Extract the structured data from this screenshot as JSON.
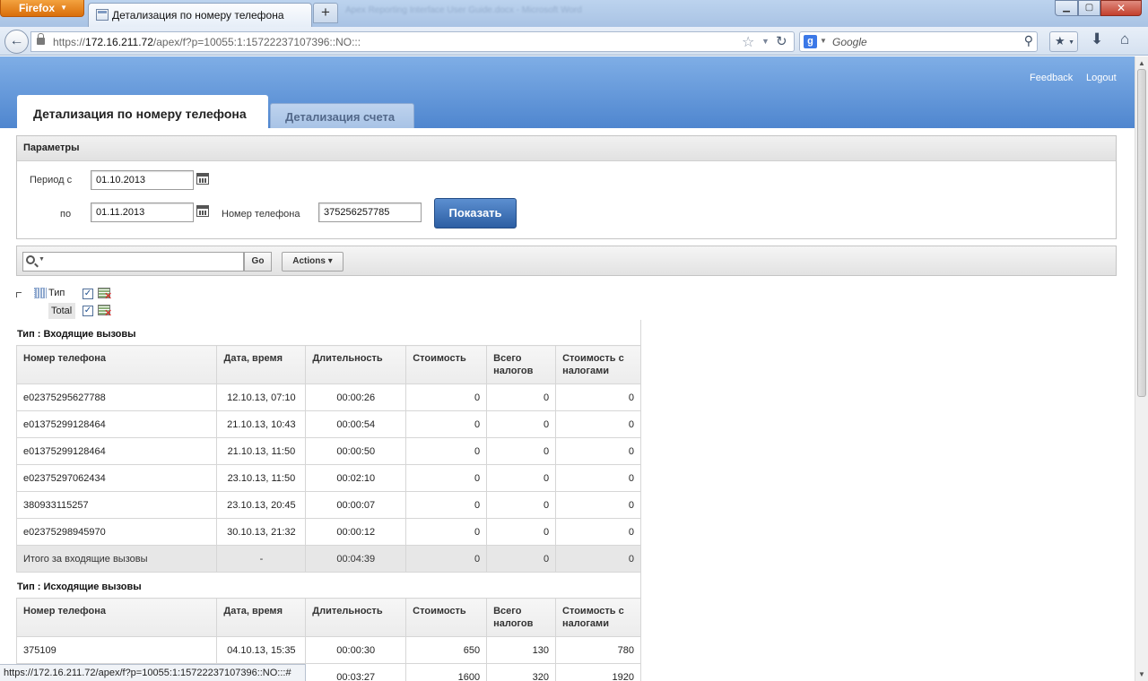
{
  "browser": {
    "menu_label": "Firefox",
    "tab_title": "Детализация по номеру телефона",
    "newtab_label": "+",
    "blurred_window_title": "Apex Reporting Interface User Guide.docx - Microsoft Word",
    "url_prefix": "https://",
    "url_host": "172.16.211.72",
    "url_path": "/apex/f?p=10055:1:15722237107396::NO:::",
    "search_placeholder": "Google",
    "status_url": "https://172.16.211.72/apex/f?p=10055:1:15722237107396::NO:::#",
    "icons": [
      "back-arrow-icon",
      "lock-icon",
      "star-icon",
      "reload-icon",
      "google-icon",
      "magnifier-icon",
      "bookmarks-icon",
      "download-icon",
      "home-icon"
    ]
  },
  "header": {
    "feedback": "Feedback",
    "logout": "Logout",
    "tabs": [
      {
        "label": "Детализация по номеру телефона",
        "active": true
      },
      {
        "label": "Детализация счета",
        "active": false
      }
    ],
    "colors": {
      "header_top": "#7faee6",
      "header_bottom": "#4f86cf",
      "button": "#2c5ea3"
    }
  },
  "params": {
    "title": "Параметры",
    "period_from_label": "Период с",
    "period_from_value": "01.10.2013",
    "period_to_label": "по",
    "period_to_value": "01.11.2013",
    "phone_label": "Номер телефона",
    "phone_value": "375256257785",
    "show_button": "Показать"
  },
  "toolbar": {
    "search_value": "",
    "go_label": "Go",
    "actions_label": "Actions ▾"
  },
  "controls": {
    "break_label": "Тип",
    "total_label": "Total",
    "break_checked": "✓",
    "total_checked": "✓"
  },
  "report": {
    "columns": [
      "Номер телефона",
      "Дата, время",
      "Длительность",
      "Стоимость",
      "Всего налогов",
      "Стоимость с налогами"
    ],
    "groups": [
      {
        "title": "Тип : Входящие вызовы",
        "rows": [
          [
            "e02375295627788",
            "12.10.13, 07:10",
            "00:00:26",
            "0",
            "0",
            "0"
          ],
          [
            "e01375299128464",
            "21.10.13, 10:43",
            "00:00:54",
            "0",
            "0",
            "0"
          ],
          [
            "e01375299128464",
            "21.10.13, 11:50",
            "00:00:50",
            "0",
            "0",
            "0"
          ],
          [
            "e02375297062434",
            "23.10.13, 11:50",
            "00:02:10",
            "0",
            "0",
            "0"
          ],
          [
            "380933115257",
            "23.10.13, 20:45",
            "00:00:07",
            "0",
            "0",
            "0"
          ],
          [
            "e02375298945970",
            "30.10.13, 21:32",
            "00:00:12",
            "0",
            "0",
            "0"
          ]
        ],
        "total": [
          "Итого за входящие вызовы",
          "-",
          "00:04:39",
          "0",
          "0",
          "0"
        ]
      },
      {
        "title": "Тип : Исходящие вызовы",
        "rows": [
          [
            "375109",
            "04.10.13, 15:35",
            "00:00:30",
            "650",
            "130",
            "780"
          ],
          [
            "",
            "",
            "00:03:27",
            "1600",
            "320",
            "1920"
          ]
        ]
      }
    ]
  }
}
